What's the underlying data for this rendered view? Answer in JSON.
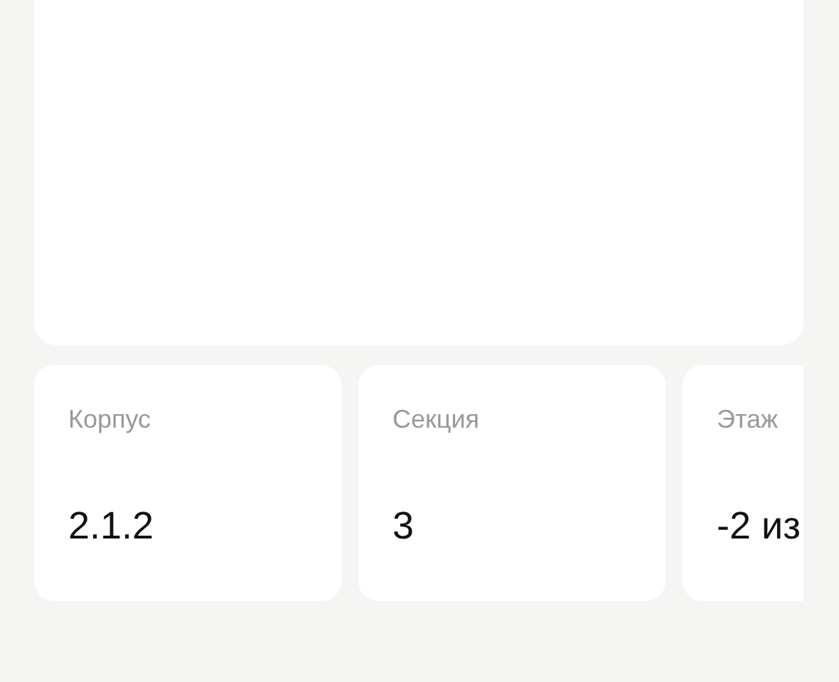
{
  "plan_card": {
    "kind": "empty"
  },
  "info_cards": [
    {
      "label": "Корпус",
      "value": "2.1.2"
    },
    {
      "label": "Секция",
      "value": "3"
    },
    {
      "label": "Этаж",
      "value": "-2 из"
    }
  ]
}
